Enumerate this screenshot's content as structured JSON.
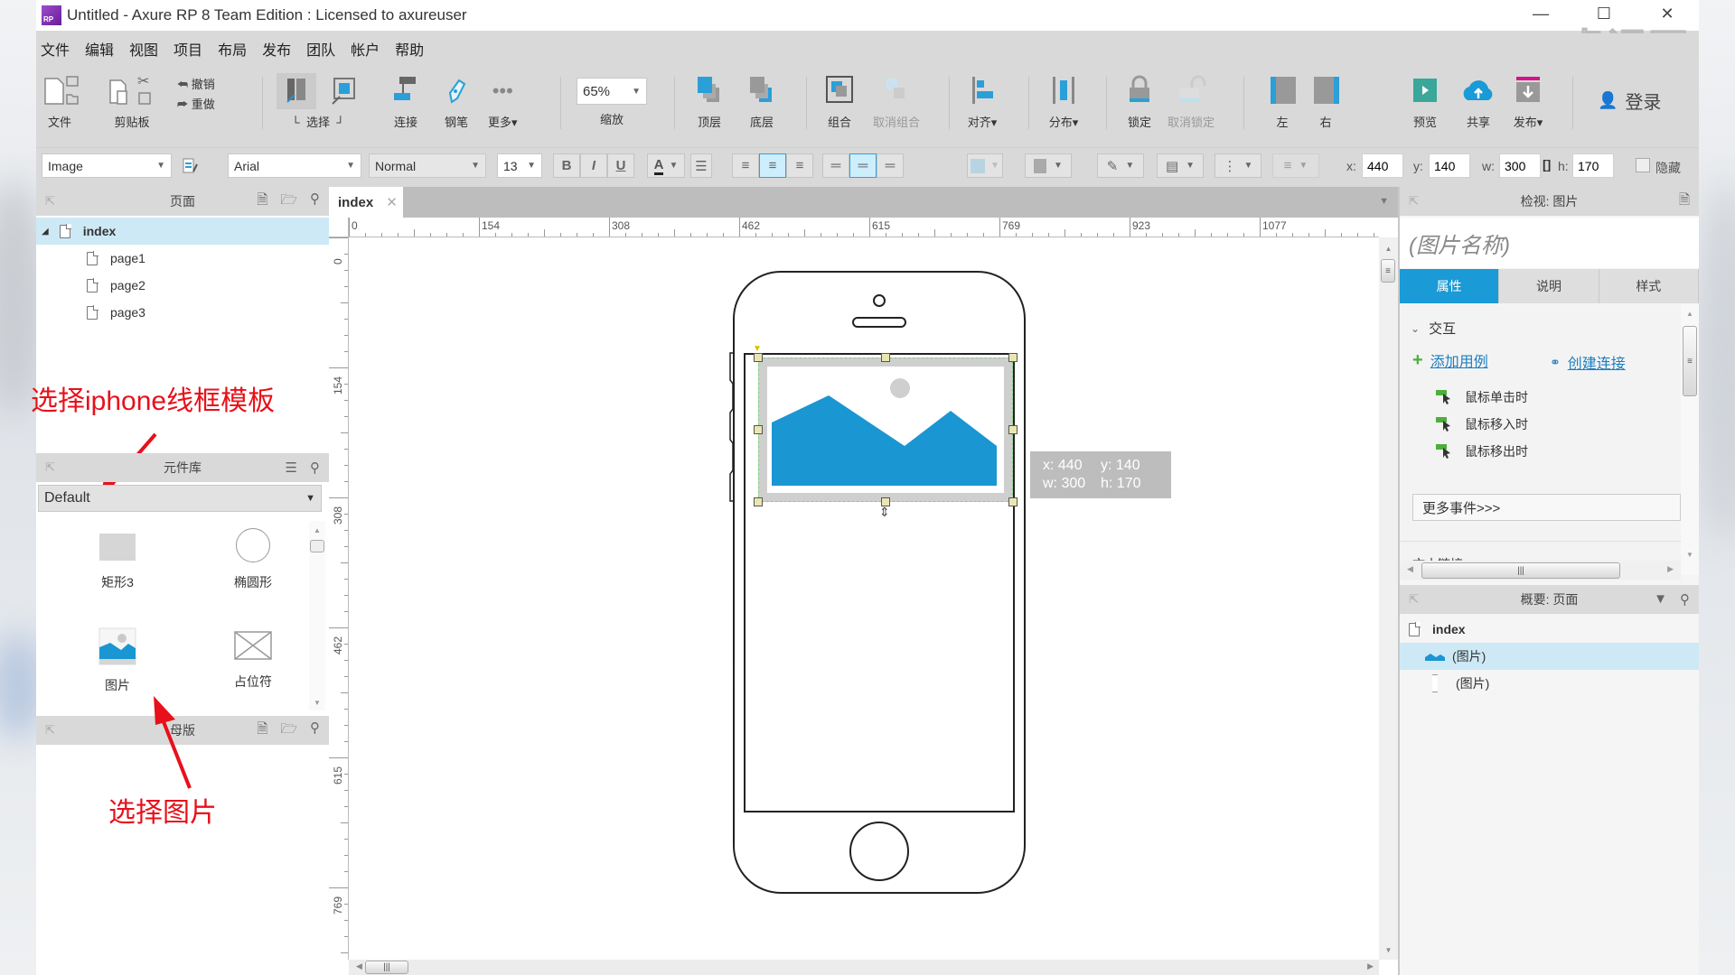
{
  "window": {
    "title": "Untitled - Axure RP 8 Team Edition : Licensed to axureuser",
    "logo_text": "RP",
    "controls": [
      "minimize",
      "maximize",
      "close"
    ],
    "watermark": "虎课网"
  },
  "menu": [
    "文件",
    "编辑",
    "视图",
    "项目",
    "布局",
    "发布",
    "团队",
    "帐户",
    "帮助"
  ],
  "toolbar": {
    "file_label": "文件",
    "clipboard_label": "剪贴板",
    "undo_label": "撤销",
    "redo_label": "重做",
    "select_label": "选择",
    "connect_label": "连接",
    "pen_label": "钢笔",
    "more_label": "更多▾",
    "zoom_value": "65%",
    "zoom_label": "缩放",
    "top_label": "顶层",
    "bottom_label": "底层",
    "group_label": "组合",
    "ungroup_label": "取消组合",
    "align_label": "对齐▾",
    "distribute_label": "分布▾",
    "lock_label": "锁定",
    "unlock_label": "取消锁定",
    "left_label": "左",
    "right_label": "右",
    "preview_label": "预览",
    "share_label": "共享",
    "publish_label": "发布▾",
    "login_label": "登录"
  },
  "format": {
    "widget_style": "Image",
    "font_family": "Arial",
    "font_weight": "Normal",
    "font_size": "13",
    "bold": "B",
    "italic": "I",
    "underline": "U",
    "font_color_glyph": "A",
    "x_label": "x:",
    "x_value": "440",
    "y_label": "y:",
    "y_value": "140",
    "w_label": "w:",
    "w_value": "300",
    "h_label": "h:",
    "h_value": "170",
    "hidden_label": "隐藏",
    "hidden_checked": false
  },
  "pages_panel": {
    "title": "页面",
    "root": "index",
    "children": [
      "page1",
      "page2",
      "page3"
    ]
  },
  "annotations": {
    "top": "选择iphone线框模板",
    "bottom": "选择图片",
    "color": "#e8101a"
  },
  "library_panel": {
    "title": "元件库",
    "selected_library": "Default",
    "items": [
      "矩形3",
      "椭圆形",
      "图片",
      "占位符"
    ]
  },
  "masters_panel": {
    "title": "母版"
  },
  "canvas": {
    "tab": "index",
    "ruler_h": [
      "0",
      "154",
      "308",
      "462",
      "615",
      "769",
      "923",
      "1077"
    ],
    "ruler_v": [
      "0",
      "154",
      "308",
      "462",
      "615",
      "769"
    ],
    "selection_tooltip": {
      "x": "x: 440",
      "y": "y: 140",
      "w": "w: 300",
      "h": "h: 170"
    },
    "image_colors": {
      "mountain": "#1a96d2",
      "sun": "#cfcfcf",
      "frame": "#cfcfcf",
      "selection": "#7ed07e"
    }
  },
  "inspector": {
    "title": "检视: 图片",
    "name_placeholder": "(图片名称)",
    "tabs": [
      "属性",
      "说明",
      "样式"
    ],
    "active_tab": "属性",
    "section": "交互",
    "add_case": "添加用例",
    "create_link": "创建连接",
    "events": [
      "鼠标单击时",
      "鼠标移入时",
      "鼠标移出时"
    ],
    "more_events": "更多事件>>>",
    "next_section": "文本链接",
    "accent": "#1a9ad6"
  },
  "outline_panel": {
    "title": "概要: 页面",
    "root": "index",
    "items": [
      "(图片)",
      "(图片)"
    ]
  }
}
